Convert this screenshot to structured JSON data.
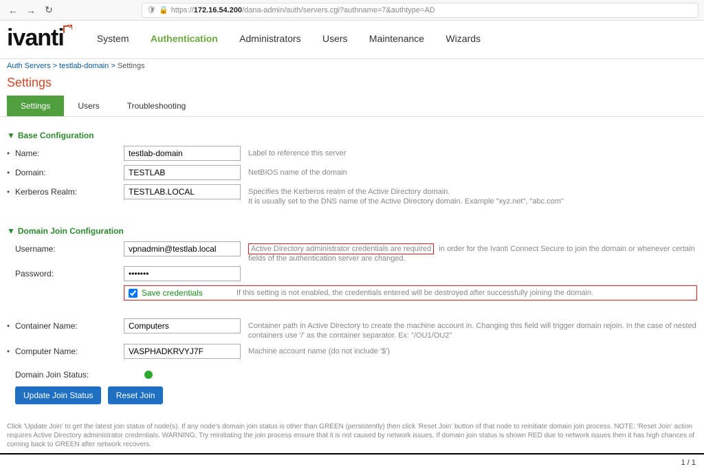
{
  "browser": {
    "url_prefix": "https://",
    "host": "172.16.54.200",
    "path": "/dana-admin/auth/servers.cgi?authname=7&authtype=AD"
  },
  "brand": "ivanti",
  "top_nav": [
    "System",
    "Authentication",
    "Administrators",
    "Users",
    "Maintenance",
    "Wizards"
  ],
  "top_nav_active_index": 1,
  "breadcrumb": {
    "items": [
      "Auth Servers",
      "testlab-domain"
    ],
    "current": "Settings"
  },
  "page_title": "Settings",
  "sub_tabs": [
    "Settings",
    "Users",
    "Troubleshooting"
  ],
  "sub_tab_active_index": 0,
  "sections": {
    "base": {
      "title": "Base Configuration",
      "name": {
        "label": "Name:",
        "value": "testlab-domain",
        "help": "Label to reference this server"
      },
      "domain": {
        "label": "Domain:",
        "value": "TESTLAB",
        "help": "NetBIOS name of the domain"
      },
      "kerberos": {
        "label": "Kerberos Realm:",
        "value": "TESTLAB.LOCAL",
        "help": "Specifies the Kerberos realm of the Active Directory domain.\nIt is usually set to the DNS name of the Active Directory domain. Example \"xyz.net\", \"abc.com\""
      }
    },
    "join": {
      "title": "Domain Join Configuration",
      "username": {
        "label": "Username:",
        "value": "vpnadmin@testlab.local",
        "help_highlight": "Active Directory administrator credentials are required",
        "help_rest": " in order for the Ivanti Connect Secure to join the domain or whenever certain fields of the authentication server are changed."
      },
      "password": {
        "label": "Password:",
        "value": "•••••••"
      },
      "save_credentials": {
        "label": "Save credentials",
        "checked": true,
        "help": "If this setting is not enabled, the credentials entered will be destroyed after successfully joining the domain."
      },
      "container": {
        "label": "Container Name:",
        "value": "Computers",
        "help": "Container path in Active Directory to create the machine account in. Changing this field will trigger domain rejoin. In the case of nested containers use '/' as the container separator. Ex: \"/OU1/OU2\""
      },
      "computer": {
        "label": "Computer Name:",
        "value": "VASPHADKRVYJ7F",
        "help": "Machine account name (do not include '$')"
      },
      "status_label": "Domain Join Status:",
      "buttons": {
        "update": "Update Join Status",
        "reset": "Reset Join"
      },
      "footnote": "Click 'Update Join' to get the latest join status of node(s). If any node's domain join status is other than GREEN (persistently) then click 'Reset Join' button of that node to reinitiate domain join process. NOTE: 'Reset Join' action requires Active Directory administrator credentials. WARNING: Try reinitiating the join process ensure that it is not caused by network issues. If domain join status is shown RED due to network issues then it has high chances of coming back to GREEN after network recovers."
    }
  },
  "page_counter": "1 / 1"
}
